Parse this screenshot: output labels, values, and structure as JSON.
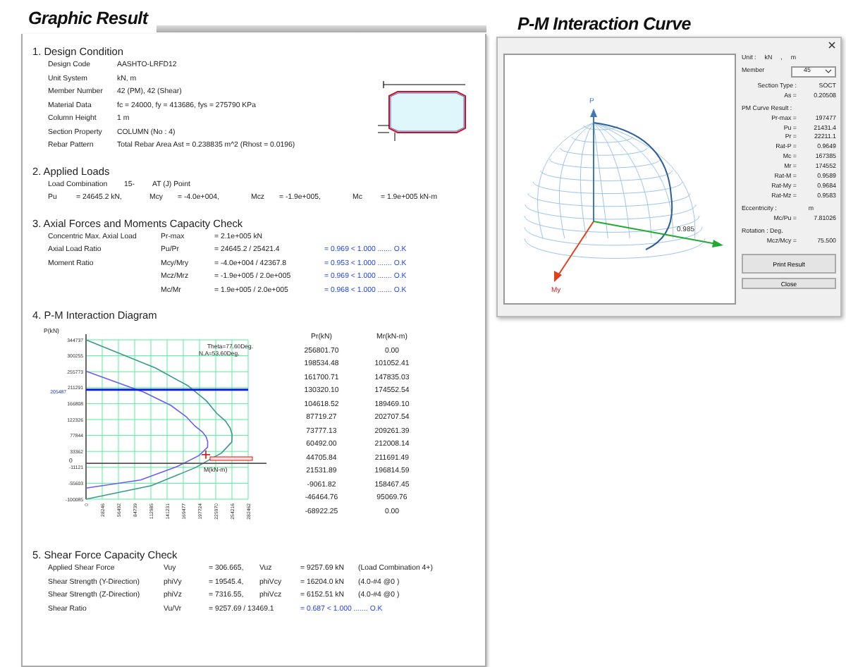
{
  "left_title": "Graphic Result",
  "design_condition": {
    "heading": "1. Design Condition",
    "rows": [
      {
        "label": "Design Code",
        "value": "AASHTO-LRFD12"
      },
      {
        "label": "Unit System",
        "value": "kN, m"
      },
      {
        "label": "Member Number",
        "value": "42 (PM), 42 (Shear)"
      },
      {
        "label": "Material Data",
        "value": "fc = 24000,   fy = 413686,   fys = 275790 KPa"
      },
      {
        "label": "Column Height",
        "value": "1 m"
      },
      {
        "label": "Section Property",
        "value": "COLUMN (No : 4)"
      },
      {
        "label": "Rebar Pattern",
        "value": "Total Rebar Area   Ast = 0.238835 m^2   (Rhost = 0.0196)"
      }
    ]
  },
  "applied_loads": {
    "heading": "2. Applied Loads",
    "combination": [
      "Load Combination",
      "15-",
      "AT (J) Point"
    ],
    "forces": [
      {
        "name": "Pu",
        "value": "= 24645.2 kN,"
      },
      {
        "name": "Mcy",
        "value": "= -4.0e+004,"
      },
      {
        "name": "Mcz",
        "value": "= -1.9e+005,"
      },
      {
        "name": "Mc",
        "value": "= 1.9e+005 kN-m"
      }
    ]
  },
  "capacity_check": {
    "heading": "3. Axial Forces and Moments Capacity Check",
    "rows": [
      {
        "label": "Concentric Max. Axial Load",
        "symbol": "Pr-max",
        "expr": "= 2.1e+005  kN"
      },
      {
        "label": "Axial Load Ratio",
        "symbol": "Pu/Pr",
        "expr": "= 24645.2 / 25421.4",
        "result": "= 0.969  < 1.000 ....... O.K"
      },
      {
        "label": "Moment Ratio",
        "symbol": "Mcy/Mry",
        "expr": "= -4.0e+004 / 42367.8",
        "result": "= 0.953  < 1.000 ....... O.K"
      },
      {
        "symbol": "Mcz/Mrz",
        "expr": "= -1.9e+005 / 2.0e+005",
        "result": "= 0.969  < 1.000 ....... O.K"
      },
      {
        "symbol": "Mc/Mr",
        "expr": "= 1.9e+005 / 2.0e+005",
        "result": "= 0.968  < 1.000 ....... O.K"
      }
    ]
  },
  "pm_diagram": {
    "heading": "4. P-M Interaction Diagram",
    "chart_data": {
      "type": "line",
      "xlabel": "M(kN-m)",
      "ylabel": "P(kN)",
      "xlim": [
        0,
        282462
      ],
      "ylim": [
        -100085,
        344737
      ],
      "xticks": [
        0,
        28246,
        56492,
        84739,
        112985,
        141231,
        169477,
        197724,
        225970,
        254216,
        282462
      ],
      "yticks": [
        344737,
        300255,
        255773,
        211291,
        166808,
        122326,
        77844,
        33362,
        -11121,
        -55603,
        -100085
      ],
      "series": [
        {
          "color": "#6a5cff",
          "x": [
            0,
            101052.41,
            147835.03,
            174552.54,
            189469.1,
            202707.54,
            209261.39,
            212008.14,
            211691.49,
            196814.59,
            158467.45,
            95069.76,
            0
          ],
          "values": [
            256801.7,
            198534.48,
            161700.71,
            130320.1,
            104618.52,
            87719.27,
            73777.13,
            60492,
            44705.84,
            21531.89,
            -9061.82,
            -46464.76,
            -68922.25
          ]
        },
        {
          "color": "#3a9a8a",
          "x": [
            0,
            121263,
            177402,
            209463,
            227363,
            243249,
            251114,
            254410,
            254030,
            236177,
            190161,
            114084,
            0
          ],
          "values": [
            344737,
            266036,
            216679,
            174629,
            140189,
            117544,
            98861,
            81059,
            59906,
            28853,
            -12143,
            -62263,
            -100085
          ]
        }
      ],
      "grid": true,
      "ref_lines": [
        {
          "axis": "y",
          "value": 205487,
          "label": "205487"
        },
        {
          "axis": "y",
          "value": 0,
          "label": "0"
        }
      ]
    },
    "notes": [
      "Theta=77.60Deg.",
      "N.A=53.60Deg."
    ],
    "table": {
      "columns": [
        "Pr(kN)",
        "Mr(kN-m)"
      ],
      "rows": [
        [
          "256801.70",
          "0.00"
        ],
        [
          "198534.48",
          "101052.41"
        ],
        [
          "161700.71",
          "147835.03"
        ],
        [
          "130320.10",
          "174552.54"
        ],
        [
          "104618.52",
          "189469.10"
        ],
        [
          "87719.27",
          "202707.54"
        ],
        [
          "73777.13",
          "209261.39"
        ],
        [
          "60492.00",
          "212008.14"
        ],
        [
          "44705.84",
          "211691.49"
        ],
        [
          "21531.89",
          "196814.59"
        ],
        [
          "-9061.82",
          "158467.45"
        ],
        [
          "-46464.76",
          "95069.76"
        ],
        [
          "-68922.25",
          "0.00"
        ]
      ]
    }
  },
  "shear_check": {
    "heading": "5. Shear Force Capacity Check",
    "rows": [
      {
        "cells": [
          "Applied Shear Force",
          "Vuy",
          "= 306.665,",
          "Vuz",
          "= 9257.69 kN",
          "(Load Combination   4+)"
        ]
      },
      {
        "cells": [
          "Shear Strength (Y-Direction)",
          "phiVy",
          "= 19545.4,",
          "phiVcy",
          "= 16204.0 kN",
          "(4.0-#4   @0  )"
        ]
      },
      {
        "cells": [
          "Shear Strength (Z-Direction)",
          "phiVz",
          "= 7316.55,",
          "phiVcz",
          "= 6152.51 kN",
          "(4.0-#4   @0  )"
        ]
      },
      {
        "cells": [
          "Shear Ratio",
          "Vu/Vr",
          "= 9257.69 / 13469.1"
        ],
        "result": "= 0.687  < 1.000 ....... O.K"
      }
    ]
  },
  "right_title": "P-M Interaction Curve",
  "curve_window": {
    "axis_labels": {
      "p": "P",
      "my": "My",
      "mz": "0.985"
    },
    "side": [
      {
        "kind": "unit",
        "label": "Unit :",
        "parts": [
          "kN",
          ",",
          "m"
        ]
      },
      {
        "kind": "select",
        "label": "Member",
        "value": "45"
      },
      {
        "kind": "pair",
        "label": "Section Type :",
        "value": "SOCT"
      },
      {
        "kind": "pair",
        "label": "As =",
        "value": "0.20508"
      },
      {
        "kind": "heading",
        "label": "PM Curve Result :"
      },
      {
        "kind": "pair",
        "label": "Pr-max =",
        "value": "197477"
      },
      {
        "kind": "pair",
        "label": "Pu =",
        "value": "21431.4"
      },
      {
        "kind": "pair",
        "label": "Pr =",
        "value": "22211.1"
      },
      {
        "kind": "pair",
        "label": "Rat-P =",
        "value": "0.9649"
      },
      {
        "kind": "pair",
        "label": "Mc =",
        "value": "167385"
      },
      {
        "kind": "pair",
        "label": "Mr =",
        "value": "174552"
      },
      {
        "kind": "pair",
        "label": "Rat-M =",
        "value": "0.9589"
      },
      {
        "kind": "pair",
        "label": "Rat-My =",
        "value": "0.9684"
      },
      {
        "kind": "pair",
        "label": "Rat-Mz =",
        "value": "0.9583"
      },
      {
        "kind": "heading",
        "label": "Eccentricity :",
        "unit": "m"
      },
      {
        "kind": "pair",
        "label": "Mc/Pu =",
        "value": "7.81026"
      },
      {
        "kind": "heading",
        "label": "Rotation : Deg."
      },
      {
        "kind": "pair",
        "label": "Mcz/Mcy =",
        "value": "75.500"
      }
    ],
    "buttons": [
      "Print Result",
      "Close"
    ]
  }
}
